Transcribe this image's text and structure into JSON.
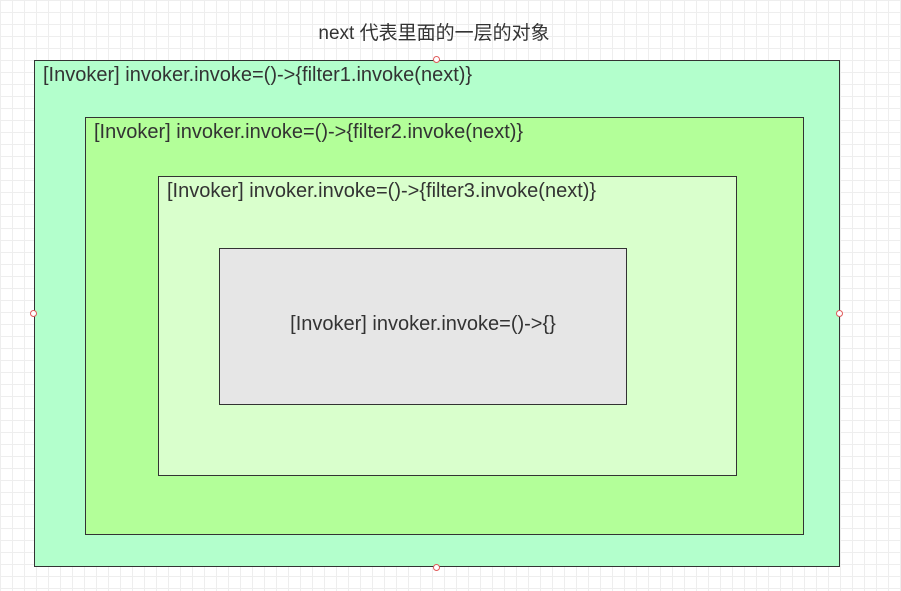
{
  "title": "next 代表里面的一层的对象",
  "layers": [
    {
      "label": "[Invoker] invoker.invoke=()->{filter1.invoke(next)}",
      "fill": "#b3ffcc"
    },
    {
      "label": "[Invoker] invoker.invoke=()->{filter2.invoke(next)}",
      "fill": "#b3ff99"
    },
    {
      "label": "[Invoker] invoker.invoke=()->{filter3.invoke(next)}",
      "fill": "#d9ffcc"
    },
    {
      "label": "[Invoker] invoker.invoke=()->{}",
      "fill": "#e6e6e6"
    }
  ],
  "colors": {
    "border": "#333333",
    "handle": "#e05a5a"
  }
}
